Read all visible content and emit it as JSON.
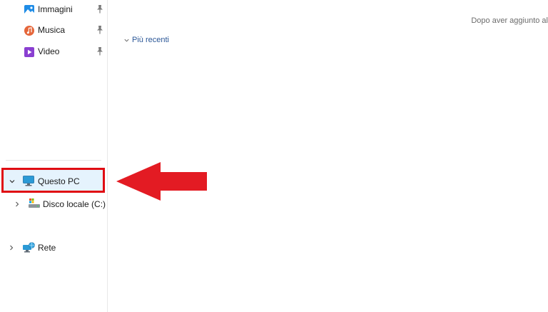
{
  "sidebar": {
    "quick_access": [
      {
        "label": "Immagini",
        "icon": "pictures-icon",
        "pinned": true
      },
      {
        "label": "Musica",
        "icon": "music-icon",
        "pinned": true
      },
      {
        "label": "Video",
        "icon": "video-icon",
        "pinned": true
      }
    ],
    "tree": {
      "this_pc": {
        "label": "Questo PC",
        "expanded": true,
        "selected": true
      },
      "local_disk": {
        "label": "Disco locale (C:)",
        "expanded": false
      },
      "network": {
        "label": "Rete",
        "expanded": false
      }
    }
  },
  "main": {
    "recent_header": "Più recenti",
    "hint_text": "Dopo aver aggiunto al"
  },
  "colors": {
    "highlight_border": "#e00d13",
    "selected_bg": "#e5f3fd",
    "arrow": "#e31b23",
    "link": "#2b5797"
  }
}
